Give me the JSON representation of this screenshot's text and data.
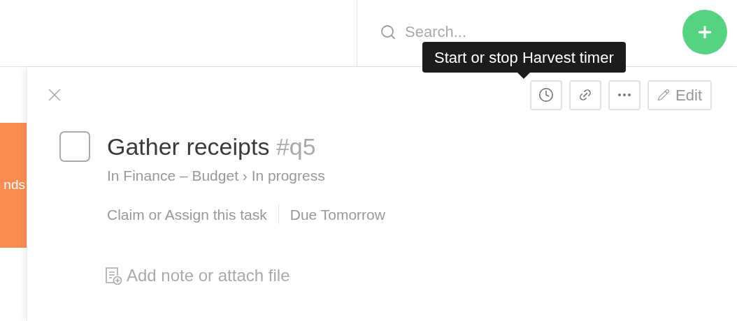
{
  "header": {
    "search": {
      "placeholder": "Search..."
    }
  },
  "side_card": {
    "text": "nds"
  },
  "tooltip": {
    "text": "Start or stop Harvest timer"
  },
  "toolbar": [
    {
      "kind": "timer"
    },
    {
      "kind": "link"
    },
    {
      "kind": "more"
    },
    {
      "kind": "edit",
      "label": "Edit"
    }
  ],
  "task": {
    "checked": false,
    "title": "Gather receipts",
    "tag": "#q5",
    "location": "In Finance – Budget › In progress",
    "assign": "Claim or Assign this task",
    "due": "Due Tomorrow"
  },
  "note": {
    "placeholder": "Add note or attach file"
  }
}
